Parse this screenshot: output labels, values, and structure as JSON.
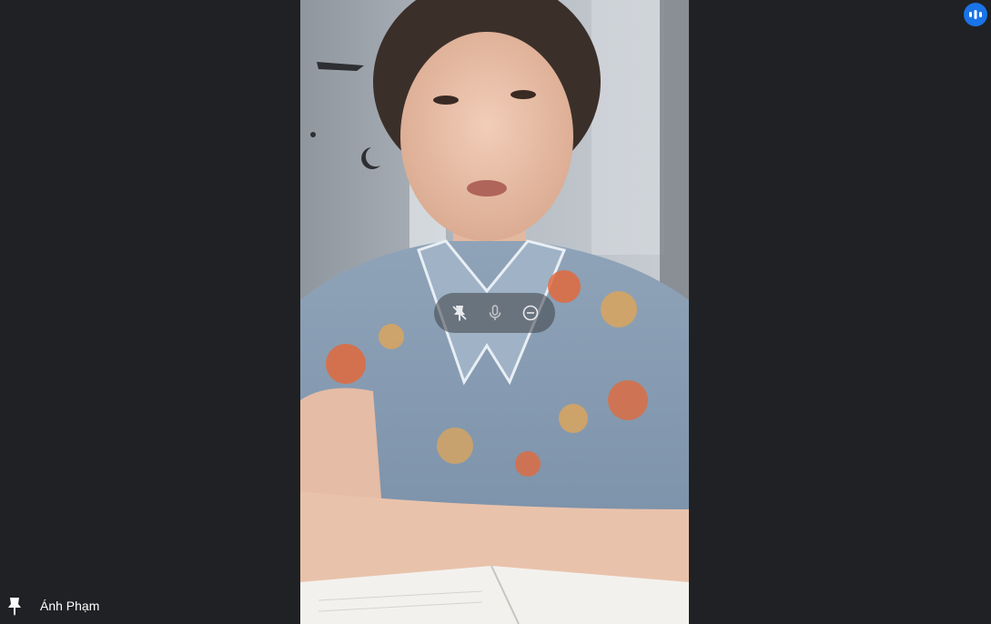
{
  "participant": {
    "name": "Ánh Phạm"
  },
  "icons": {
    "pin": "pin-icon",
    "pin_off": "pin-off-icon",
    "microphone": "microphone-icon",
    "remove": "remove-icon",
    "speaking": "audio-level-icon"
  },
  "colors": {
    "background": "#202124",
    "accent": "#1a73e8",
    "name_text": "#ffffff"
  }
}
